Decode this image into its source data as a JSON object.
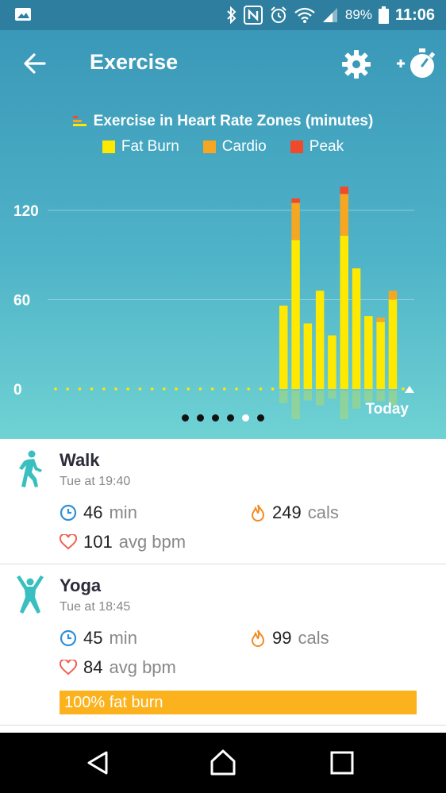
{
  "status_bar": {
    "battery": "89%",
    "time": "11:06"
  },
  "app_bar": {
    "title": "Exercise"
  },
  "chart_data": {
    "type": "bar",
    "title": "Exercise in Heart Rate Zones (minutes)",
    "legend": [
      "Fat Burn",
      "Cardio",
      "Peak"
    ],
    "colors": {
      "fat_burn": "#ffe900",
      "cardio": "#f5a623",
      "peak": "#f04a2b"
    },
    "yticks": [
      0,
      60,
      120
    ],
    "ylim": [
      0,
      135
    ],
    "empty_days": 19,
    "series": [
      {
        "name": "Fat Burn",
        "values": [
          56,
          100,
          44,
          66,
          36,
          103,
          81,
          49,
          45,
          60
        ]
      },
      {
        "name": "Cardio",
        "values": [
          0,
          25,
          0,
          0,
          0,
          28,
          0,
          0,
          3,
          6
        ]
      },
      {
        "name": "Peak",
        "values": [
          0,
          3,
          0,
          0,
          0,
          5,
          0,
          0,
          0,
          0
        ]
      }
    ],
    "x_end_label": "Today",
    "legend_position": "top-center",
    "grid": true
  },
  "pager": {
    "count": 6,
    "active_index": 4
  },
  "activities": [
    {
      "name": "Walk",
      "when": "Tue at 19:40",
      "icon": "walk-icon",
      "duration_value": "46",
      "duration_unit": "min",
      "calories_value": "249",
      "calories_unit": "cals",
      "bpm_value": "101",
      "bpm_unit": "avg bpm"
    },
    {
      "name": "Yoga",
      "when": "Tue at 18:45",
      "icon": "yoga-icon",
      "duration_value": "45",
      "duration_unit": "min",
      "calories_value": "99",
      "calories_unit": "cals",
      "bpm_value": "84",
      "bpm_unit": "avg bpm",
      "zone_label": "100% fat burn",
      "zone_fraction": 1.0
    }
  ]
}
